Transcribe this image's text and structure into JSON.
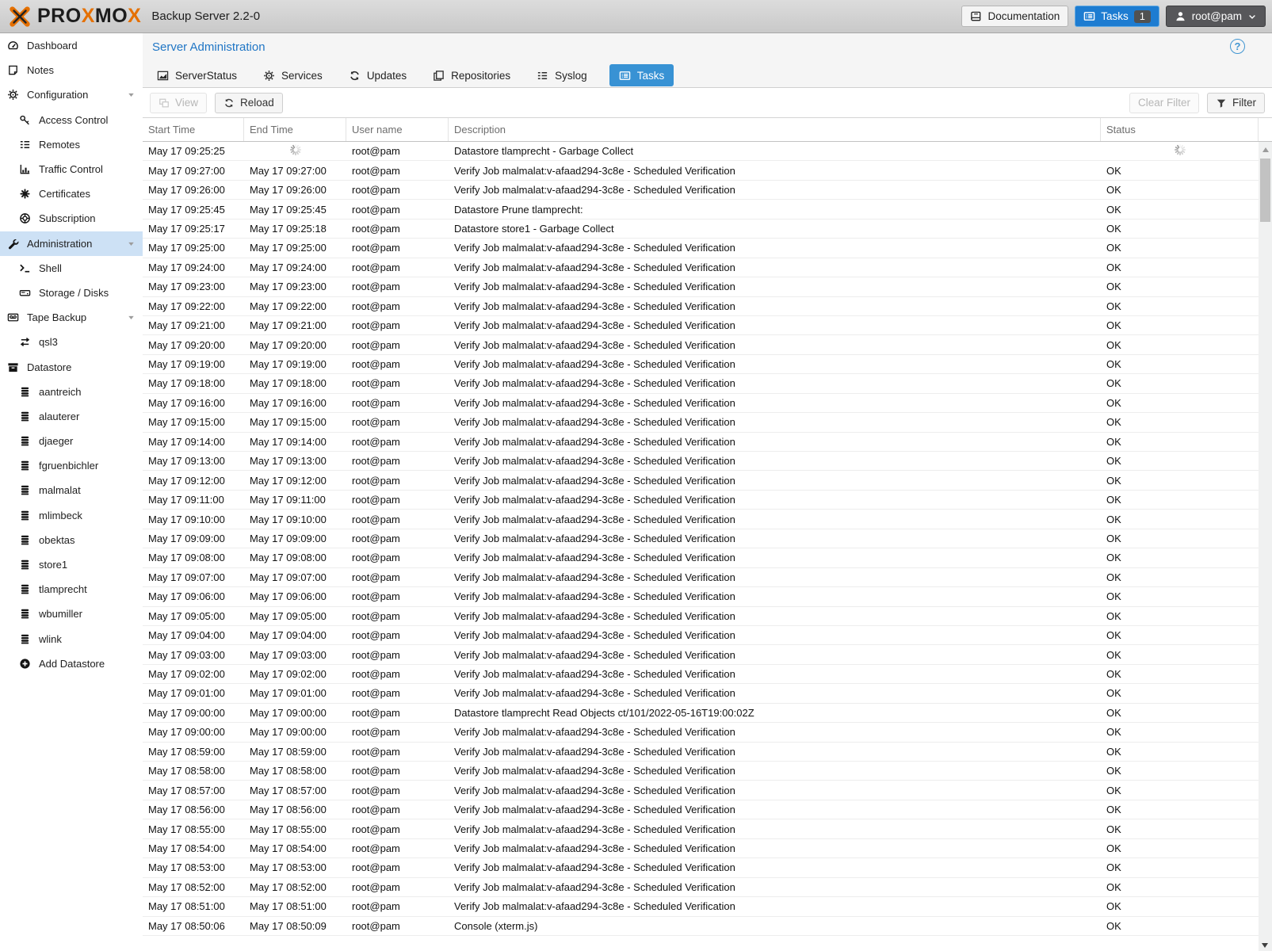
{
  "topbar": {
    "logo_parts": [
      {
        "text": "PRO",
        "orange": false
      },
      {
        "text": "X",
        "orange": true
      },
      {
        "text": "MO",
        "orange": false
      },
      {
        "text": "X",
        "orange": true
      }
    ],
    "subtitle": "Backup Server 2.2-0",
    "documentation_label": "Documentation",
    "tasks_label": "Tasks",
    "tasks_badge": "1",
    "user_label": "root@pam"
  },
  "sidebar": {
    "items": [
      {
        "label": "Dashboard",
        "icon": "gauge-icon",
        "indent": 0,
        "expandable": false,
        "selected": false
      },
      {
        "label": "Notes",
        "icon": "note-icon",
        "indent": 0,
        "expandable": false,
        "selected": false
      },
      {
        "label": "Configuration",
        "icon": "gears-icon",
        "indent": 0,
        "expandable": true,
        "selected": false
      },
      {
        "label": "Access Control",
        "icon": "key-icon",
        "indent": 1,
        "expandable": false,
        "selected": false
      },
      {
        "label": "Remotes",
        "icon": "list-lines-icon",
        "indent": 1,
        "expandable": false,
        "selected": false
      },
      {
        "label": "Traffic Control",
        "icon": "chart-bars-icon",
        "indent": 1,
        "expandable": false,
        "selected": false
      },
      {
        "label": "Certificates",
        "icon": "certificate-icon",
        "indent": 1,
        "expandable": false,
        "selected": false
      },
      {
        "label": "Subscription",
        "icon": "lifering-icon",
        "indent": 1,
        "expandable": false,
        "selected": false
      },
      {
        "label": "Administration",
        "icon": "wrench-icon",
        "indent": 0,
        "expandable": true,
        "selected": true
      },
      {
        "label": "Shell",
        "icon": "terminal-icon",
        "indent": 1,
        "expandable": false,
        "selected": false
      },
      {
        "label": "Storage / Disks",
        "icon": "hdd-icon",
        "indent": 1,
        "expandable": false,
        "selected": false
      },
      {
        "label": "Tape Backup",
        "icon": "tape-icon",
        "indent": 0,
        "expandable": true,
        "selected": false
      },
      {
        "label": "qsl3",
        "icon": "exchange-icon",
        "indent": 1,
        "expandable": false,
        "selected": false
      },
      {
        "label": "Datastore",
        "icon": "archive-icon",
        "indent": 0,
        "expandable": false,
        "selected": false
      },
      {
        "label": "aantreich",
        "icon": "database-icon",
        "indent": 1,
        "expandable": false,
        "selected": false
      },
      {
        "label": "alauterer",
        "icon": "database-icon",
        "indent": 1,
        "expandable": false,
        "selected": false
      },
      {
        "label": "djaeger",
        "icon": "database-icon",
        "indent": 1,
        "expandable": false,
        "selected": false
      },
      {
        "label": "fgruenbichler",
        "icon": "database-icon",
        "indent": 1,
        "expandable": false,
        "selected": false
      },
      {
        "label": "malmalat",
        "icon": "database-icon",
        "indent": 1,
        "expandable": false,
        "selected": false
      },
      {
        "label": "mlimbeck",
        "icon": "database-icon",
        "indent": 1,
        "expandable": false,
        "selected": false
      },
      {
        "label": "obektas",
        "icon": "database-icon",
        "indent": 1,
        "expandable": false,
        "selected": false
      },
      {
        "label": "store1",
        "icon": "database-icon",
        "indent": 1,
        "expandable": false,
        "selected": false
      },
      {
        "label": "tlamprecht",
        "icon": "database-icon",
        "indent": 1,
        "expandable": false,
        "selected": false
      },
      {
        "label": "wbumiller",
        "icon": "database-icon",
        "indent": 1,
        "expandable": false,
        "selected": false
      },
      {
        "label": "wlink",
        "icon": "database-icon",
        "indent": 1,
        "expandable": false,
        "selected": false
      },
      {
        "label": "Add Datastore",
        "icon": "plus-circle-icon",
        "indent": 1,
        "expandable": false,
        "selected": false
      }
    ]
  },
  "content": {
    "title": "Server Administration",
    "help_label": "?",
    "tabs": [
      {
        "label": "ServerStatus",
        "icon": "chart-area-icon",
        "active": false
      },
      {
        "label": "Services",
        "icon": "gears-icon",
        "active": false
      },
      {
        "label": "Updates",
        "icon": "refresh-icon",
        "active": false
      },
      {
        "label": "Repositories",
        "icon": "copy-icon",
        "active": false
      },
      {
        "label": "Syslog",
        "icon": "list-lines-icon",
        "active": false
      },
      {
        "label": "Tasks",
        "icon": "list-alt-icon",
        "active": true
      }
    ],
    "toolbar": {
      "view_label": "View",
      "reload_label": "Reload",
      "clear_filter_label": "Clear Filter",
      "filter_label": "Filter"
    },
    "table": {
      "columns": [
        "Start Time",
        "End Time",
        "User name",
        "Description",
        "Status"
      ],
      "rows": [
        {
          "start": "May 17 09:25:25",
          "end": null,
          "user": "root@pam",
          "desc": "Datastore tlamprecht - Garbage Collect",
          "status": null
        },
        {
          "start": "May 17 09:27:00",
          "end": "May 17 09:27:00",
          "user": "root@pam",
          "desc": "Verify Job malmalat:v-afaad294-3c8e - Scheduled Verification",
          "status": "OK"
        },
        {
          "start": "May 17 09:26:00",
          "end": "May 17 09:26:00",
          "user": "root@pam",
          "desc": "Verify Job malmalat:v-afaad294-3c8e - Scheduled Verification",
          "status": "OK"
        },
        {
          "start": "May 17 09:25:45",
          "end": "May 17 09:25:45",
          "user": "root@pam",
          "desc": "Datastore Prune tlamprecht:",
          "status": "OK"
        },
        {
          "start": "May 17 09:25:17",
          "end": "May 17 09:25:18",
          "user": "root@pam",
          "desc": "Datastore store1 - Garbage Collect",
          "status": "OK"
        },
        {
          "start": "May 17 09:25:00",
          "end": "May 17 09:25:00",
          "user": "root@pam",
          "desc": "Verify Job malmalat:v-afaad294-3c8e - Scheduled Verification",
          "status": "OK"
        },
        {
          "start": "May 17 09:24:00",
          "end": "May 17 09:24:00",
          "user": "root@pam",
          "desc": "Verify Job malmalat:v-afaad294-3c8e - Scheduled Verification",
          "status": "OK"
        },
        {
          "start": "May 17 09:23:00",
          "end": "May 17 09:23:00",
          "user": "root@pam",
          "desc": "Verify Job malmalat:v-afaad294-3c8e - Scheduled Verification",
          "status": "OK"
        },
        {
          "start": "May 17 09:22:00",
          "end": "May 17 09:22:00",
          "user": "root@pam",
          "desc": "Verify Job malmalat:v-afaad294-3c8e - Scheduled Verification",
          "status": "OK"
        },
        {
          "start": "May 17 09:21:00",
          "end": "May 17 09:21:00",
          "user": "root@pam",
          "desc": "Verify Job malmalat:v-afaad294-3c8e - Scheduled Verification",
          "status": "OK"
        },
        {
          "start": "May 17 09:20:00",
          "end": "May 17 09:20:00",
          "user": "root@pam",
          "desc": "Verify Job malmalat:v-afaad294-3c8e - Scheduled Verification",
          "status": "OK"
        },
        {
          "start": "May 17 09:19:00",
          "end": "May 17 09:19:00",
          "user": "root@pam",
          "desc": "Verify Job malmalat:v-afaad294-3c8e - Scheduled Verification",
          "status": "OK"
        },
        {
          "start": "May 17 09:18:00",
          "end": "May 17 09:18:00",
          "user": "root@pam",
          "desc": "Verify Job malmalat:v-afaad294-3c8e - Scheduled Verification",
          "status": "OK"
        },
        {
          "start": "May 17 09:16:00",
          "end": "May 17 09:16:00",
          "user": "root@pam",
          "desc": "Verify Job malmalat:v-afaad294-3c8e - Scheduled Verification",
          "status": "OK"
        },
        {
          "start": "May 17 09:15:00",
          "end": "May 17 09:15:00",
          "user": "root@pam",
          "desc": "Verify Job malmalat:v-afaad294-3c8e - Scheduled Verification",
          "status": "OK"
        },
        {
          "start": "May 17 09:14:00",
          "end": "May 17 09:14:00",
          "user": "root@pam",
          "desc": "Verify Job malmalat:v-afaad294-3c8e - Scheduled Verification",
          "status": "OK"
        },
        {
          "start": "May 17 09:13:00",
          "end": "May 17 09:13:00",
          "user": "root@pam",
          "desc": "Verify Job malmalat:v-afaad294-3c8e - Scheduled Verification",
          "status": "OK"
        },
        {
          "start": "May 17 09:12:00",
          "end": "May 17 09:12:00",
          "user": "root@pam",
          "desc": "Verify Job malmalat:v-afaad294-3c8e - Scheduled Verification",
          "status": "OK"
        },
        {
          "start": "May 17 09:11:00",
          "end": "May 17 09:11:00",
          "user": "root@pam",
          "desc": "Verify Job malmalat:v-afaad294-3c8e - Scheduled Verification",
          "status": "OK"
        },
        {
          "start": "May 17 09:10:00",
          "end": "May 17 09:10:00",
          "user": "root@pam",
          "desc": "Verify Job malmalat:v-afaad294-3c8e - Scheduled Verification",
          "status": "OK"
        },
        {
          "start": "May 17 09:09:00",
          "end": "May 17 09:09:00",
          "user": "root@pam",
          "desc": "Verify Job malmalat:v-afaad294-3c8e - Scheduled Verification",
          "status": "OK"
        },
        {
          "start": "May 17 09:08:00",
          "end": "May 17 09:08:00",
          "user": "root@pam",
          "desc": "Verify Job malmalat:v-afaad294-3c8e - Scheduled Verification",
          "status": "OK"
        },
        {
          "start": "May 17 09:07:00",
          "end": "May 17 09:07:00",
          "user": "root@pam",
          "desc": "Verify Job malmalat:v-afaad294-3c8e - Scheduled Verification",
          "status": "OK"
        },
        {
          "start": "May 17 09:06:00",
          "end": "May 17 09:06:00",
          "user": "root@pam",
          "desc": "Verify Job malmalat:v-afaad294-3c8e - Scheduled Verification",
          "status": "OK"
        },
        {
          "start": "May 17 09:05:00",
          "end": "May 17 09:05:00",
          "user": "root@pam",
          "desc": "Verify Job malmalat:v-afaad294-3c8e - Scheduled Verification",
          "status": "OK"
        },
        {
          "start": "May 17 09:04:00",
          "end": "May 17 09:04:00",
          "user": "root@pam",
          "desc": "Verify Job malmalat:v-afaad294-3c8e - Scheduled Verification",
          "status": "OK"
        },
        {
          "start": "May 17 09:03:00",
          "end": "May 17 09:03:00",
          "user": "root@pam",
          "desc": "Verify Job malmalat:v-afaad294-3c8e - Scheduled Verification",
          "status": "OK"
        },
        {
          "start": "May 17 09:02:00",
          "end": "May 17 09:02:00",
          "user": "root@pam",
          "desc": "Verify Job malmalat:v-afaad294-3c8e - Scheduled Verification",
          "status": "OK"
        },
        {
          "start": "May 17 09:01:00",
          "end": "May 17 09:01:00",
          "user": "root@pam",
          "desc": "Verify Job malmalat:v-afaad294-3c8e - Scheduled Verification",
          "status": "OK"
        },
        {
          "start": "May 17 09:00:00",
          "end": "May 17 09:00:00",
          "user": "root@pam",
          "desc": "Datastore tlamprecht Read Objects ct/101/2022-05-16T19:00:02Z",
          "status": "OK"
        },
        {
          "start": "May 17 09:00:00",
          "end": "May 17 09:00:00",
          "user": "root@pam",
          "desc": "Verify Job malmalat:v-afaad294-3c8e - Scheduled Verification",
          "status": "OK"
        },
        {
          "start": "May 17 08:59:00",
          "end": "May 17 08:59:00",
          "user": "root@pam",
          "desc": "Verify Job malmalat:v-afaad294-3c8e - Scheduled Verification",
          "status": "OK"
        },
        {
          "start": "May 17 08:58:00",
          "end": "May 17 08:58:00",
          "user": "root@pam",
          "desc": "Verify Job malmalat:v-afaad294-3c8e - Scheduled Verification",
          "status": "OK"
        },
        {
          "start": "May 17 08:57:00",
          "end": "May 17 08:57:00",
          "user": "root@pam",
          "desc": "Verify Job malmalat:v-afaad294-3c8e - Scheduled Verification",
          "status": "OK"
        },
        {
          "start": "May 17 08:56:00",
          "end": "May 17 08:56:00",
          "user": "root@pam",
          "desc": "Verify Job malmalat:v-afaad294-3c8e - Scheduled Verification",
          "status": "OK"
        },
        {
          "start": "May 17 08:55:00",
          "end": "May 17 08:55:00",
          "user": "root@pam",
          "desc": "Verify Job malmalat:v-afaad294-3c8e - Scheduled Verification",
          "status": "OK"
        },
        {
          "start": "May 17 08:54:00",
          "end": "May 17 08:54:00",
          "user": "root@pam",
          "desc": "Verify Job malmalat:v-afaad294-3c8e - Scheduled Verification",
          "status": "OK"
        },
        {
          "start": "May 17 08:53:00",
          "end": "May 17 08:53:00",
          "user": "root@pam",
          "desc": "Verify Job malmalat:v-afaad294-3c8e - Scheduled Verification",
          "status": "OK"
        },
        {
          "start": "May 17 08:52:00",
          "end": "May 17 08:52:00",
          "user": "root@pam",
          "desc": "Verify Job malmalat:v-afaad294-3c8e - Scheduled Verification",
          "status": "OK"
        },
        {
          "start": "May 17 08:51:00",
          "end": "May 17 08:51:00",
          "user": "root@pam",
          "desc": "Verify Job malmalat:v-afaad294-3c8e - Scheduled Verification",
          "status": "OK"
        },
        {
          "start": "May 17 08:50:06",
          "end": "May 17 08:50:09",
          "user": "root@pam",
          "desc": "Console (xterm.js)",
          "status": "OK"
        }
      ]
    }
  },
  "colors": {
    "proxmox_orange": "#E57000",
    "accent_blue": "#3892d4",
    "topbar_tasks_button_blue": "#1d7cd1",
    "user_button_gray": "#57575a",
    "sidebar_selected_blue": "#cde1f5",
    "title_blue": "#2076c5"
  }
}
